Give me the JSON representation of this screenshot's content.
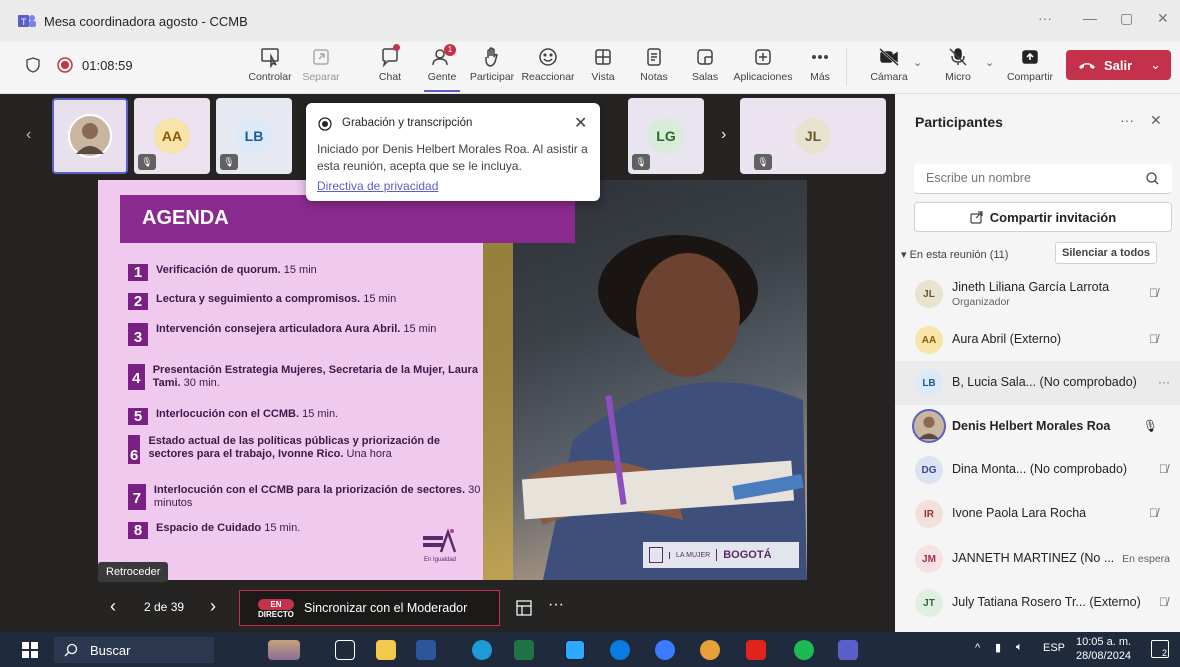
{
  "window": {
    "title": "Mesa coordinadora agosto - CCMB",
    "controls": [
      "···",
      "—",
      "▢",
      "✕"
    ]
  },
  "toolbar": {
    "recording_time": "01:08:59",
    "items": [
      {
        "label": "Controlar"
      },
      {
        "label": "Separar"
      },
      {
        "label": "Chat"
      },
      {
        "label": "Gente",
        "badge": "1"
      },
      {
        "label": "Participar"
      },
      {
        "label": "Reaccionar"
      },
      {
        "label": "Vista"
      },
      {
        "label": "Notas"
      },
      {
        "label": "Salas"
      },
      {
        "label": "Aplicaciones"
      },
      {
        "label": "Más"
      }
    ],
    "camera_label": "Cámara",
    "mic_label": "Micro",
    "share_label": "Compartir",
    "leave_label": "Salir"
  },
  "thumbnails": [
    {
      "initials": "",
      "color": "#ffffff"
    },
    {
      "initials": "AA",
      "color": "#f8e3a8"
    },
    {
      "initials": "LB",
      "color": "#dceaf8"
    },
    {
      "initials": "LG",
      "color": "#d9ecd9"
    },
    {
      "initials": "JL",
      "color": "#e8e2d0"
    }
  ],
  "recording_popup": {
    "title": "Grabación y transcripción",
    "body": "Iniciado por Denis Helbert Morales Roa. Al asistir a esta reunión, acepta que se le incluya.",
    "link": "Directiva de privacidad"
  },
  "slide": {
    "heading": "AGENDA",
    "items": [
      {
        "num": "1",
        "bold": "Verificación de quorum.",
        "rest": " 15 min"
      },
      {
        "num": "2",
        "bold": "Lectura y seguimiento a compromisos.",
        "rest": " 15 min"
      },
      {
        "num": "3",
        "bold": "Intervención consejera articuladora Aura Abril.",
        "rest": " 15 min"
      },
      {
        "num": "4",
        "bold": "Presentación Estrategia Mujeres, Secretaria de la Mujer, Laura Tami.",
        "rest": " 30 min."
      },
      {
        "num": "5",
        "bold": "Interlocución con el CCMB.",
        "rest": " 15 min."
      },
      {
        "num": "6",
        "bold": "Estado actual de las políticas públicas y priorización de sectores para el trabajo, Ivonne Rico.",
        "rest": " Una hora"
      },
      {
        "num": "7",
        "bold": "Interlocución con el CCMB para la priorización de sectores.",
        "rest": " 30 minutos"
      },
      {
        "num": "8",
        "bold": "Espacio de Cuidado",
        "rest": " 15 min."
      }
    ],
    "logo_left_caption": "En Igualdad",
    "logo_right_1": "LA MUJER",
    "logo_right_2": "BOGOTÁ"
  },
  "tooltip": "Retroceder",
  "navigation": {
    "page": "2 de 39",
    "live_line1": "EN",
    "live_line2": "DIRECTO",
    "sync_label": "Sincronizar con el Moderador"
  },
  "panel": {
    "title": "Participantes",
    "search_placeholder": "Escribe un nombre",
    "share_invite": "Compartir invitación",
    "section": "En esta reunión (11)",
    "mute_all": "Silenciar a todos",
    "participants": [
      {
        "initials": "JL",
        "name": "Jineth Liliana García Larrota",
        "role": "Organizador",
        "color": "#e8e2d0",
        "status": "muted"
      },
      {
        "initials": "AA",
        "name": "Aura Abril (Externo)",
        "role": "",
        "color": "#f8e3a8",
        "status": "muted"
      },
      {
        "initials": "LB",
        "name": "B, Lucia Sala... (No comprobado)",
        "role": "",
        "color": "#dceaf8",
        "status": "more"
      },
      {
        "initials": "",
        "name": "Denis Helbert Morales Roa",
        "role": "",
        "color": "#ffffff",
        "status": "mic"
      },
      {
        "initials": "DG",
        "name": "Dina Monta... (No comprobado)",
        "role": "",
        "color": "#dbe3f3",
        "status": "muted"
      },
      {
        "initials": "IR",
        "name": "Ivone Paola Lara Rocha",
        "role": "",
        "color": "#f3e0dc",
        "status": "muted"
      },
      {
        "initials": "JM",
        "name": "JANNETH MARTINEZ (No ...",
        "role": "",
        "color": "#f8e1e3",
        "status": "En espera"
      },
      {
        "initials": "JT",
        "name": "July Tatiana Rosero Tr... (Externo)",
        "role": "",
        "color": "#dfefe1",
        "status": "muted"
      }
    ]
  },
  "taskbar": {
    "search": "Buscar",
    "lang": "ESP",
    "time": "10:05 a. m.",
    "date": "28/08/2024",
    "notif": "2"
  }
}
